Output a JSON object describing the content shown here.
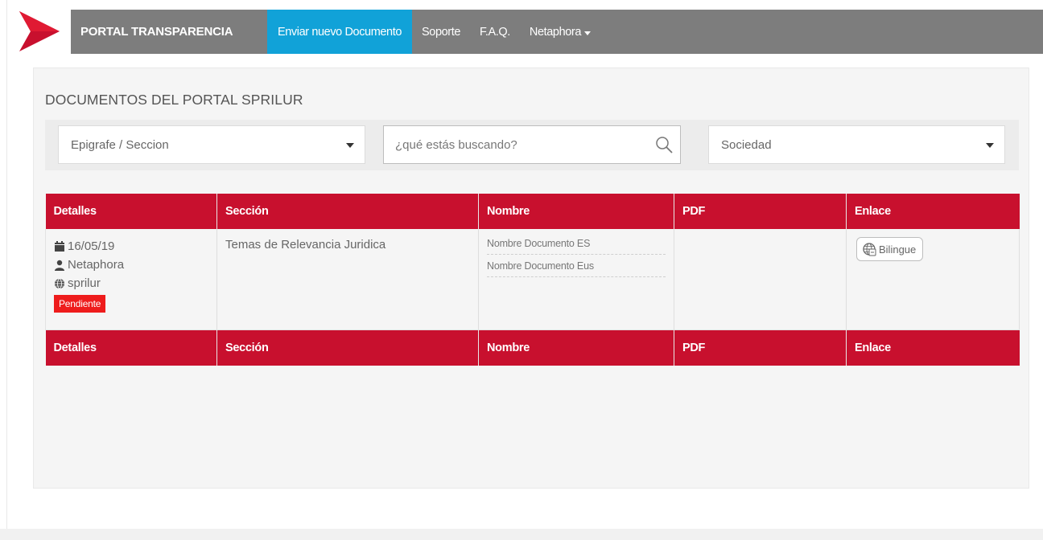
{
  "navbar": {
    "brand": "PORTAL TRANSPARENCIA",
    "items": [
      {
        "label": "Enviar nuevo Documento",
        "active": true
      },
      {
        "label": "Soporte"
      },
      {
        "label": "F.A.Q."
      },
      {
        "label": "Netaphora",
        "dropdown": true
      }
    ],
    "background": "#7d7d7d",
    "active_color": "#11a2d8"
  },
  "page": {
    "title": "DOCUMENTOS DEL PORTAL SPRILUR"
  },
  "filters": {
    "epigrafe": {
      "selected": "Epigrafe / Seccion"
    },
    "search": {
      "placeholder": "¿qué estás buscando?",
      "value": ""
    },
    "sociedad": {
      "selected": "Sociedad"
    }
  },
  "table": {
    "headers": [
      "Detalles",
      "Sección",
      "Nombre",
      "PDF",
      "Enlace"
    ],
    "footer_headers": [
      "Detalles",
      "Sección",
      "Nombre",
      "PDF",
      "Enlace"
    ],
    "header_color": "#c8102e",
    "rows": [
      {
        "date": "16/05/19",
        "user": "Netaphora",
        "site": "sprilur",
        "status": "Pendiente",
        "section": "Temas de Relevancia Juridica",
        "names": [
          "Nombre Documento ES",
          "Nombre Documento Eus"
        ],
        "pdf": "",
        "link_label": "Bilingue"
      }
    ]
  },
  "icons": {
    "logo": "red-arrow-logo",
    "search": "search-icon",
    "date": "calendar-icon",
    "user": "user-icon",
    "site": "globe-icon",
    "link": "globe-language-icon"
  },
  "colors": {
    "status_badge": "#ee1c1c",
    "logo_red": "#c8102e"
  }
}
